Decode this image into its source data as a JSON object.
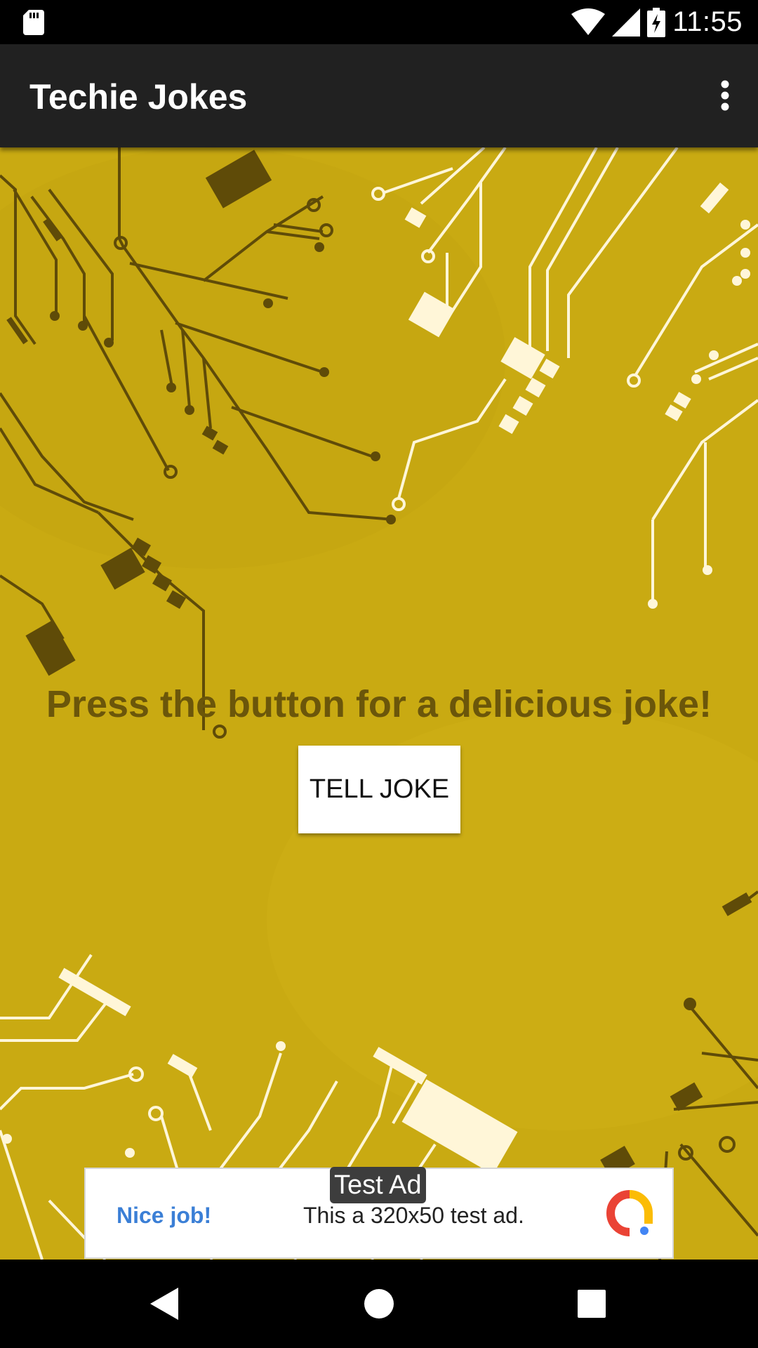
{
  "status_bar": {
    "time": "11:55",
    "icons": [
      "sd-card-icon",
      "wifi-icon",
      "signal-icon",
      "battery-charging-icon"
    ]
  },
  "app_bar": {
    "title": "Techie Jokes",
    "overflow_icon": "more-vert-icon"
  },
  "main": {
    "headline": "Press the button for a delicious joke!",
    "button_label": "TELL JOKE",
    "background_color": "#c9aa12",
    "headline_color": "#6b560a"
  },
  "ad": {
    "tag": "Test Ad",
    "headline": "Nice job!",
    "description": "This a 320x50 test ad.",
    "logo_icon": "admob-logo-icon"
  },
  "nav_bar": {
    "back_icon": "back-icon",
    "home_icon": "home-icon",
    "recents_icon": "recents-icon"
  }
}
